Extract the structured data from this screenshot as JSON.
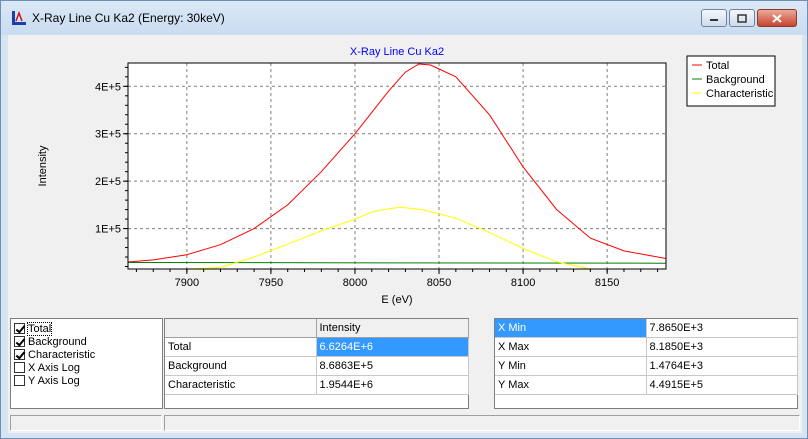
{
  "window": {
    "title": "X-Ray Line Cu Ka2 (Energy: 30keV)",
    "buttons": {
      "minimize": "minimize-icon",
      "maximize": "maximize-icon",
      "close": "close-icon"
    }
  },
  "colors": {
    "total": "#ff0000",
    "background": "#008000",
    "characteristic": "#ffff00",
    "selection": "#3399ff"
  },
  "chart_data": {
    "type": "line",
    "title": "X-Ray Line Cu Ka2",
    "xlabel": "E (eV)",
    "ylabel": "Intensity",
    "xlim": [
      7865,
      8185
    ],
    "ylim": [
      14764,
      449150
    ],
    "xticks": [
      7900,
      7950,
      8000,
      8050,
      8100,
      8150
    ],
    "xtick_labels": [
      "7900",
      "7950",
      "8000",
      "8050",
      "8100",
      "8150"
    ],
    "yticks": [
      100000,
      200000,
      300000,
      400000
    ],
    "ytick_labels": [
      "1E+5",
      "2E+5",
      "3E+5",
      "4E+5"
    ],
    "grid": true,
    "legend": "top-right",
    "series": [
      {
        "name": "Total",
        "x": [
          7865,
          7880,
          7900,
          7920,
          7940,
          7960,
          7980,
          8000,
          8010,
          8020,
          8030,
          8038,
          8045,
          8060,
          8080,
          8100,
          8120,
          8140,
          8160,
          8185
        ],
        "y": [
          29500,
          34000,
          45000,
          66000,
          100000,
          150000,
          220000,
          300000,
          345000,
          390000,
          430000,
          447000,
          445000,
          420000,
          340000,
          230000,
          140000,
          80000,
          53000,
          37000
        ]
      },
      {
        "name": "Background",
        "x": [
          7865,
          8185
        ],
        "y": [
          28500,
          27000
        ]
      },
      {
        "name": "Characteristic",
        "x": [
          7865,
          7900,
          7920,
          7940,
          7960,
          7980,
          8000,
          8010,
          8020,
          8027,
          8040,
          8060,
          8080,
          8100,
          8120,
          8140,
          8160,
          8185
        ],
        "y": [
          0,
          5000,
          18000,
          40000,
          67000,
          95000,
          120000,
          135000,
          142000,
          145000,
          140000,
          122000,
          92000,
          58000,
          30000,
          12000,
          3000,
          0
        ]
      }
    ]
  },
  "checks": [
    {
      "label": "Total",
      "checked": true
    },
    {
      "label": "Background",
      "checked": true
    },
    {
      "label": "Characteristic",
      "checked": true
    },
    {
      "label": "X Axis Log",
      "checked": false
    },
    {
      "label": "Y Axis Log",
      "checked": false
    }
  ],
  "intensity_table": {
    "header": "Intensity",
    "rows": [
      {
        "name": "Total",
        "value": "6.6264E+6"
      },
      {
        "name": "Background",
        "value": "8.6863E+5"
      },
      {
        "name": "Characteristic",
        "value": "1.9544E+6"
      }
    ]
  },
  "range_table": {
    "rows": [
      {
        "name": "X Min",
        "value": "7.8650E+3"
      },
      {
        "name": "X Max",
        "value": "8.1850E+3"
      },
      {
        "name": "Y Min",
        "value": "1.4764E+3"
      },
      {
        "name": "Y Max",
        "value": "4.4915E+5"
      }
    ]
  }
}
